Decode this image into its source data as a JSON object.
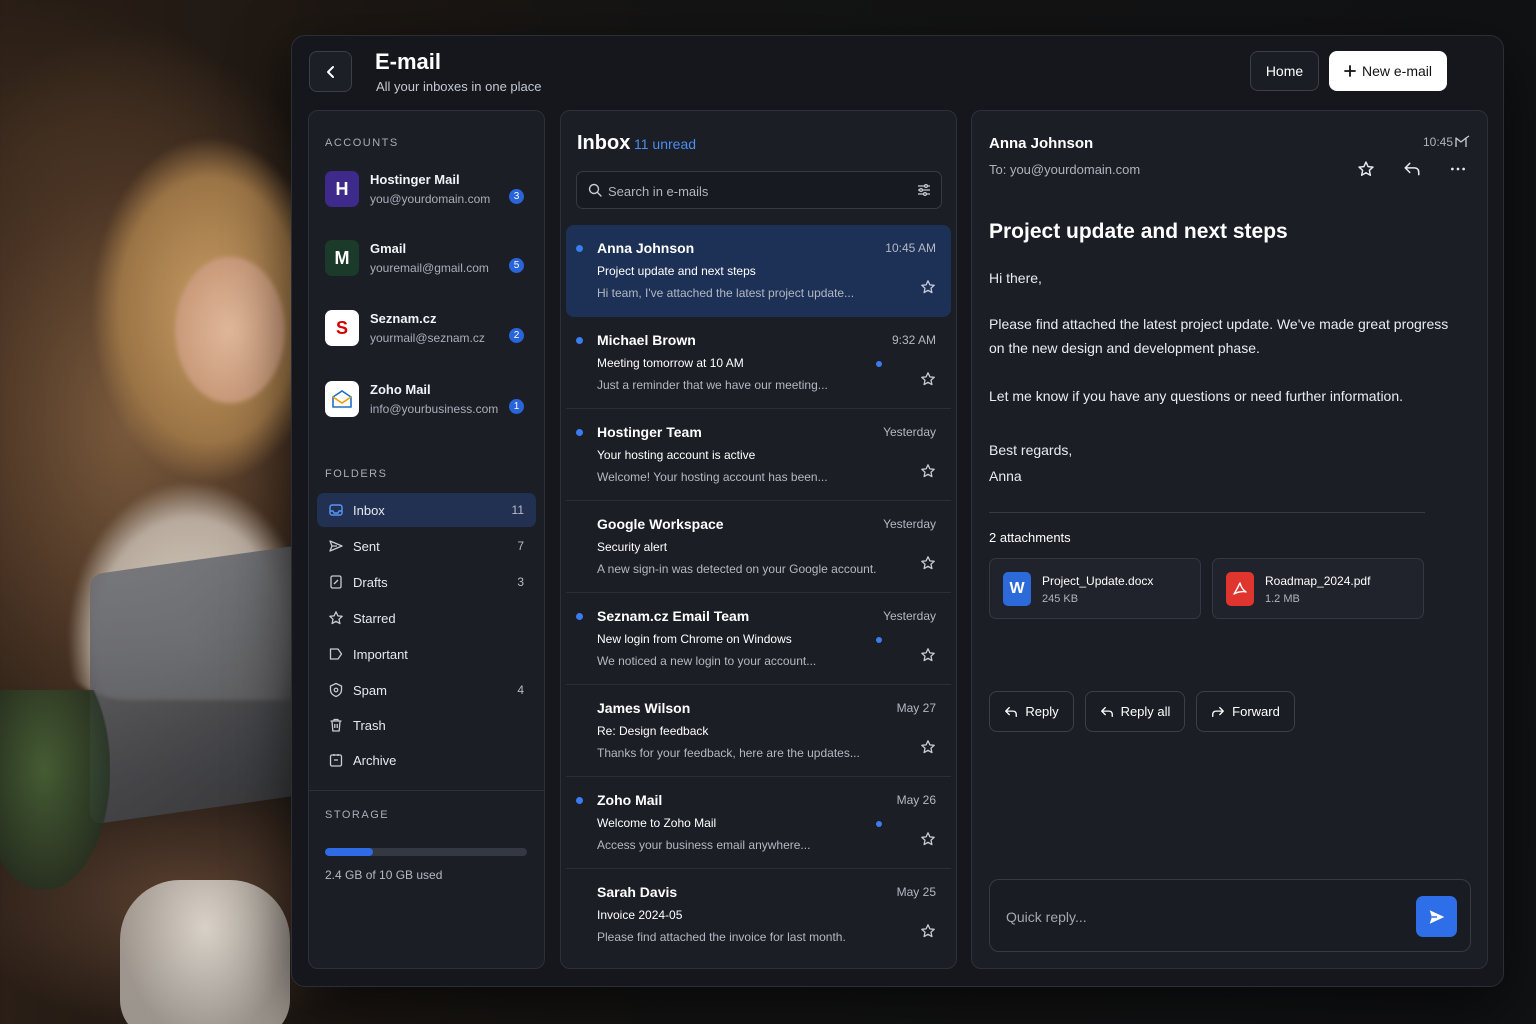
{
  "header": {
    "title": "E-mail",
    "subtitle": "All your inboxes in one place",
    "home_label": "Home",
    "new_label": "New e-mail"
  },
  "sidebar": {
    "accounts_label": "ACCOUNTS",
    "accounts": [
      {
        "name": "Hostinger Mail",
        "email": "you@yourdomain.com",
        "count": "3",
        "logo": "hostinger-logo",
        "logo_text": "H",
        "color": "#673de6"
      },
      {
        "name": "Gmail",
        "email": "youremail@gmail.com",
        "count": "5",
        "logo": "gmail-logo",
        "logo_text": "M",
        "color": "#ea4335"
      },
      {
        "name": "Seznam.cz",
        "email": "yourmail@seznam.cz",
        "count": "2",
        "logo": "seznam-logo",
        "logo_text": "S",
        "color": "#cc0000"
      },
      {
        "name": "Zoho Mail",
        "email": "info@yourbusiness.com",
        "count": "1",
        "logo": "zoho-logo",
        "logo_text": "",
        "color": "#1e73be"
      }
    ],
    "folders_label": "FOLDERS",
    "folders": [
      {
        "label": "Inbox",
        "count": "11",
        "icon": "inbox-icon"
      },
      {
        "label": "Sent",
        "count": "7",
        "icon": "send-icon"
      },
      {
        "label": "Drafts",
        "count": "3",
        "icon": "draft-icon"
      },
      {
        "label": "Starred",
        "count": "",
        "icon": "star-icon"
      },
      {
        "label": "Important",
        "count": "",
        "icon": "label-icon"
      },
      {
        "label": "Spam",
        "count": "4",
        "icon": "shield-icon"
      },
      {
        "label": "Trash",
        "count": "",
        "icon": "trash-icon"
      },
      {
        "label": "Archive",
        "count": "",
        "icon": "archive-icon"
      }
    ],
    "storage_label": "STORAGE",
    "storage_used_fraction": 0.24,
    "storage_text": "2.4 GB of 10 GB used"
  },
  "inbox": {
    "title": "Inbox",
    "unread": "11 unread",
    "search_placeholder": "Search in e-mails",
    "mails": [
      {
        "sender": "Anna Johnson",
        "time": "10:45 AM",
        "subject": "Project update and next steps",
        "preview": "Hi team, I've attached the latest project update...",
        "unread": true
      },
      {
        "sender": "Michael Brown",
        "time": "9:32 AM",
        "subject": "Meeting tomorrow at 10 AM",
        "preview": "Just a reminder that we have our meeting...",
        "unread": true
      },
      {
        "sender": "Hostinger Team",
        "time": "Yesterday",
        "subject": "Your hosting account is active",
        "preview": "Welcome! Your hosting account has been...",
        "unread": true
      },
      {
        "sender": "Google Workspace",
        "time": "Yesterday",
        "subject": "Security alert",
        "preview": "A new sign-in was detected on your Google account.",
        "unread": false
      },
      {
        "sender": "Seznam.cz Email Team",
        "time": "Yesterday",
        "subject": "New login from Chrome on Windows",
        "preview": "We noticed a new login to your account...",
        "unread": true
      },
      {
        "sender": "James Wilson",
        "time": "May 27",
        "subject": "Re: Design feedback",
        "preview": "Thanks for your feedback, here are the updates...",
        "unread": false
      },
      {
        "sender": "Zoho Mail",
        "time": "May 26",
        "subject": "Welcome to Zoho Mail",
        "preview": "Access your business email anywhere...",
        "unread": true
      },
      {
        "sender": "Sarah Davis",
        "time": "May 25",
        "subject": "Invoice 2024-05",
        "preview": "Please find attached the invoice for last month.",
        "unread": false
      }
    ]
  },
  "reader": {
    "from": "Anna Johnson",
    "to": "To: you@yourdomain.com",
    "time": "10:45",
    "subject": "Project update and next steps",
    "greeting": "Hi there,",
    "paragraph1": "Please find attached the latest project update. We've made great progress on the new design and development phase.",
    "paragraph2": "Let me know if you have any questions or need further information.",
    "closing": "Best regards,",
    "signature": "Anna",
    "attachments_label": "2 attachments",
    "attachments": [
      {
        "name": "Project_Update.docx",
        "size": "245 KB",
        "icon": "word-icon",
        "icon_text": "W",
        "color": "#2b6ad8"
      },
      {
        "name": "Roadmap_2024.pdf",
        "size": "1.2 MB",
        "icon": "pdf-icon",
        "icon_text": "",
        "color": "#e0342f"
      }
    ],
    "reply_label": "Reply",
    "reply_all_label": "Reply all",
    "forward_label": "Forward",
    "quick_reply_placeholder": "Quick reply..."
  }
}
